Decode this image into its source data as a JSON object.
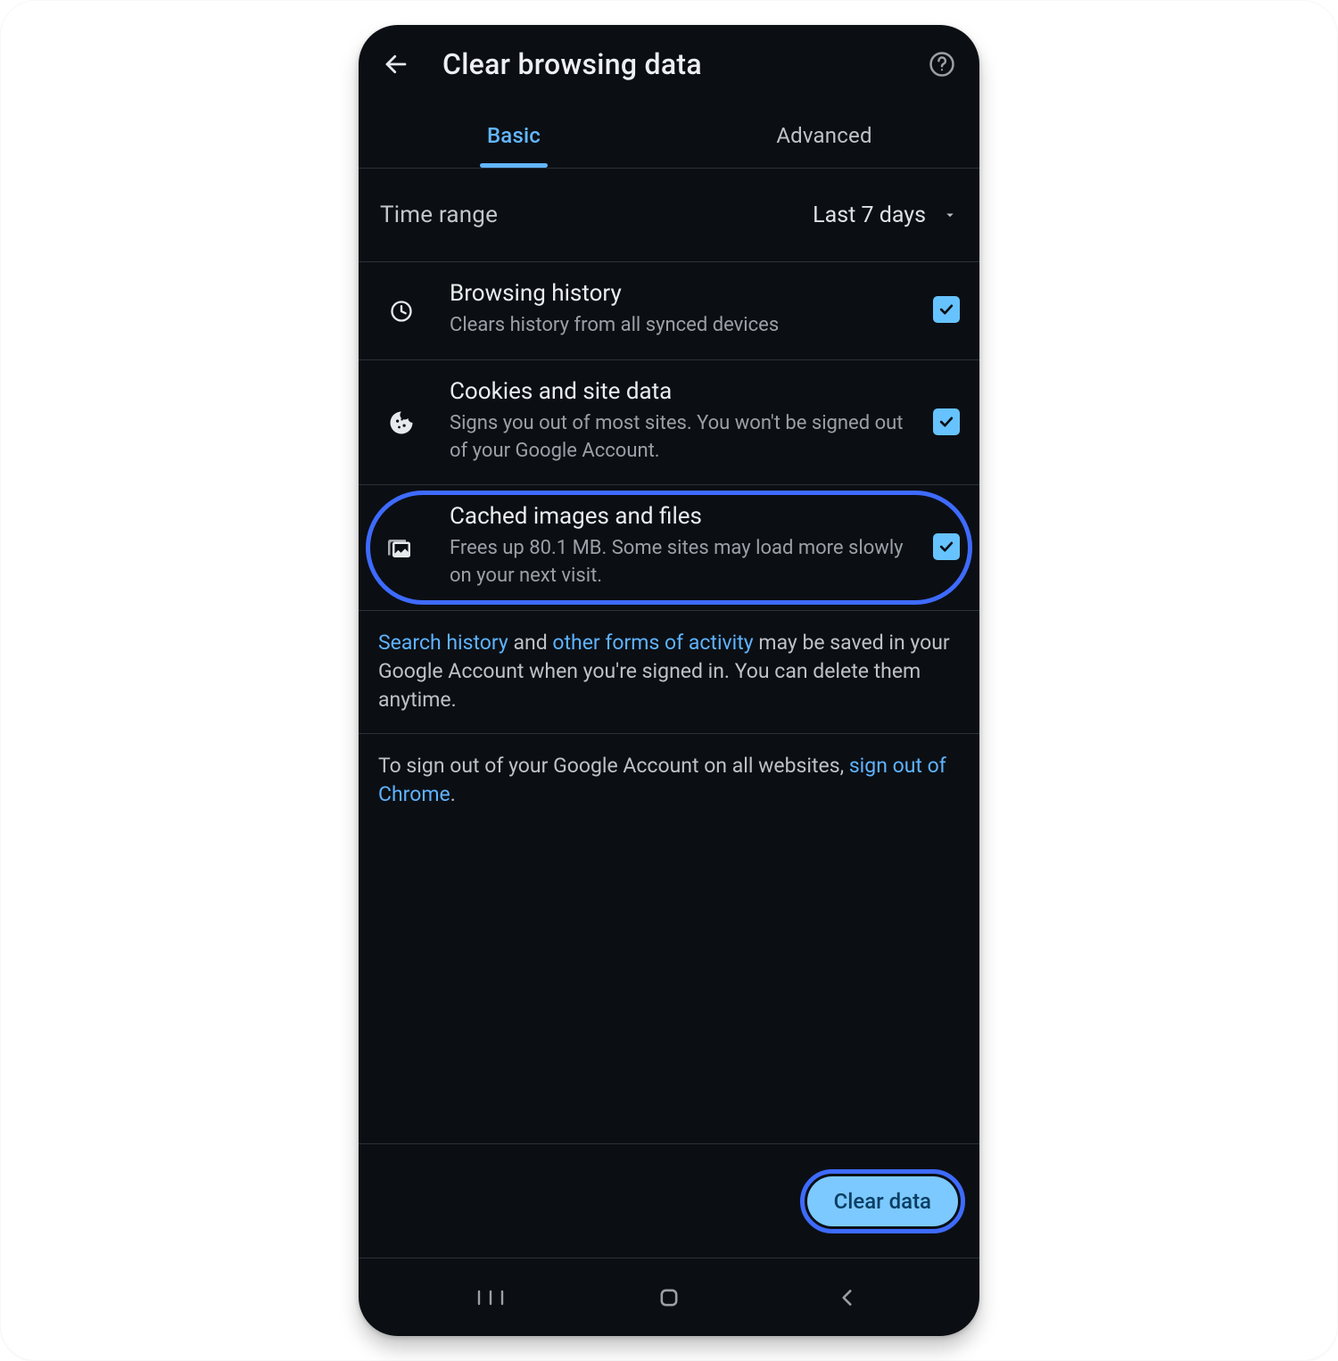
{
  "colors": {
    "accent": "#62B6FF",
    "highlight_ring": "#3E6BFF",
    "checkbox_fill": "#66C3FF",
    "primary_button_bg": "#7CC9FF",
    "primary_button_text": "#0A3E63",
    "link": "#5FB3FF"
  },
  "header": {
    "title": "Clear browsing data"
  },
  "tabs": {
    "basic": "Basic",
    "advanced": "Advanced",
    "active": "basic"
  },
  "time_range": {
    "label": "Time range",
    "value": "Last 7 days"
  },
  "items": {
    "history": {
      "title": "Browsing history",
      "sub": "Clears history from all synced devices",
      "checked": true
    },
    "cookies": {
      "title": "Cookies and site data",
      "sub": "Signs you out of most sites. You won't be signed out of your Google Account.",
      "checked": true
    },
    "cache": {
      "title": "Cached images and files",
      "sub": "Frees up 80.1 MB. Some sites may load more slowly on your next visit.",
      "checked": true,
      "highlighted": true
    }
  },
  "info1": {
    "pre": "",
    "link1": "Search history",
    "mid1": " and ",
    "link2": "other forms of activity",
    "post": " may be saved in your Google Account when you're signed in. You can delete them anytime."
  },
  "info2": {
    "pre": "To sign out of your Google Account on all websites, ",
    "link1": "sign out of Chrome",
    "post": "."
  },
  "actions": {
    "clear": "Clear data"
  }
}
